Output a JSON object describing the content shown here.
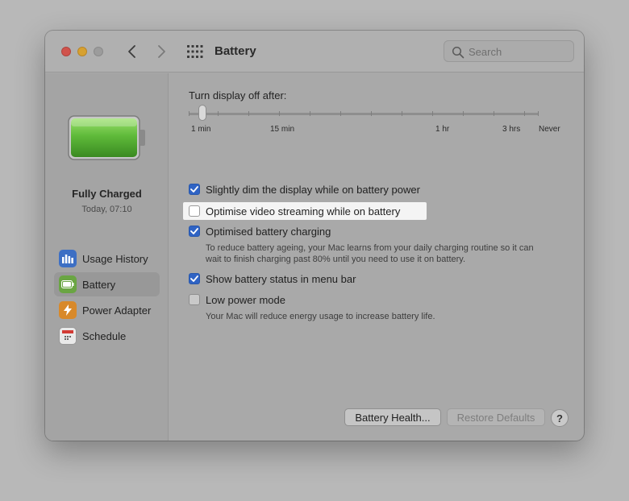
{
  "window": {
    "title": "Battery",
    "search_placeholder": "Search"
  },
  "icons": {
    "close": "close-button",
    "minimize": "minimize-button",
    "zoom": "zoom-button",
    "back": "chevron-left-icon",
    "forward": "chevron-right-icon",
    "grid": "grid-icon",
    "search": "search-icon",
    "battery": "battery-full-icon"
  },
  "sidebar": {
    "status_title": "Fully Charged",
    "status_time": "Today, 07:10",
    "items": [
      {
        "label": "Usage History",
        "icon": "bar-chart-icon",
        "selected": false
      },
      {
        "label": "Battery",
        "icon": "battery-icon",
        "selected": true
      },
      {
        "label": "Power Adapter",
        "icon": "lightning-icon",
        "selected": false
      },
      {
        "label": "Schedule",
        "icon": "calendar-icon",
        "selected": false
      }
    ]
  },
  "main": {
    "slider": {
      "label": "Turn display off after:",
      "ticks": {
        "min": "1 min",
        "fifteen": "15 min",
        "hour": "1 hr",
        "three": "3 hrs",
        "never": "Never"
      },
      "value": "1 min"
    },
    "options": [
      {
        "label": "Slightly dim the display while on battery power",
        "checked": true
      },
      {
        "label": "Optimise video streaming while on battery",
        "checked": false
      },
      {
        "label": "Optimised battery charging",
        "checked": true,
        "description_line1": "To reduce battery ageing, your Mac learns from your daily charging routine so it can",
        "description_line2": "wait to finish charging past 80% until you need to use it on battery."
      },
      {
        "label": "Show battery status in menu bar",
        "checked": true
      },
      {
        "label": "Low power mode",
        "checked": false,
        "description_line1": "Your Mac will reduce energy usage to increase battery life."
      }
    ]
  },
  "buttons": {
    "battery_health": "Battery Health...",
    "restore_defaults": "Restore Defaults",
    "help": "?"
  },
  "colors": {
    "accent": "#2f63c4",
    "battery_green": "#5fba3a"
  }
}
